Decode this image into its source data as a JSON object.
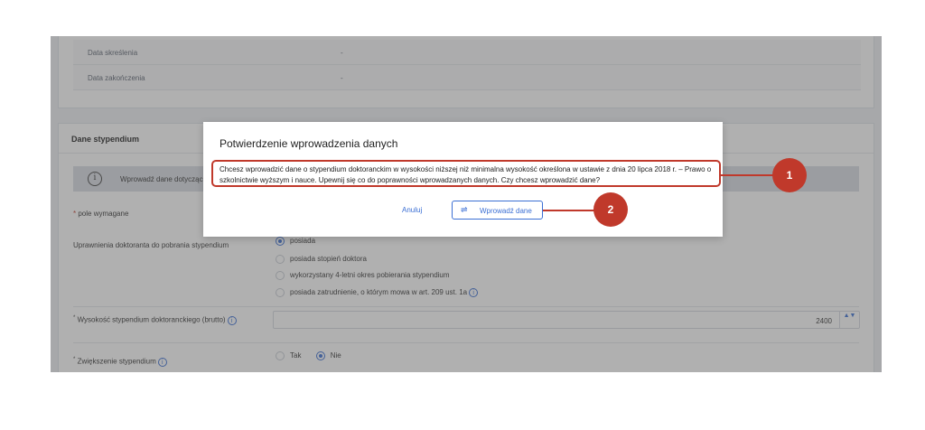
{
  "details": [
    {
      "label": "Data skreślenia",
      "value": "-"
    },
    {
      "label": "Data zakończenia",
      "value": "-"
    }
  ],
  "section": {
    "title": "Dane stypendium",
    "info_text": "Wprowadź dane dotyczące",
    "required_star": "*",
    "required_note": "pole wymagane"
  },
  "entitlement": {
    "label": "Uprawnienia doktoranta do pobrania stypendium",
    "options": [
      "posiada",
      "posiada stopień doktora",
      "wykorzystany 4-letni okres pobierania stypendium",
      "posiada zatrudnienie, o którym mowa w art. 209 ust. 1a"
    ]
  },
  "amount": {
    "label": "Wysokość stypendium doktoranckiego (brutto)",
    "value": "2400",
    "stepper": "▲▼"
  },
  "increase": {
    "label": "Zwiększenie stypendium",
    "options": [
      "Tak",
      "Nie"
    ]
  },
  "modal": {
    "title": "Potwierdzenie wprowadzenia danych",
    "message": "Chcesz wprowadzić dane o stypendium doktoranckim w wysokości niższej niż minimalna wysokość określona w ustawie z dnia 20 lipca 2018 r. – Prawo o szkolnictwie wyższym i nauce. Upewnij się co do poprawności wprowadzanych danych. Czy chcesz wprowadzić dane?",
    "cancel_label": "Anuluj",
    "submit_label": "Wprowadź dane",
    "submit_icon": "⇌"
  },
  "callouts": [
    "1",
    "2"
  ],
  "icons": {
    "info": "i",
    "help": "i"
  },
  "colors": {
    "accent": "#3b6fd4",
    "callout": "#c0392b"
  }
}
